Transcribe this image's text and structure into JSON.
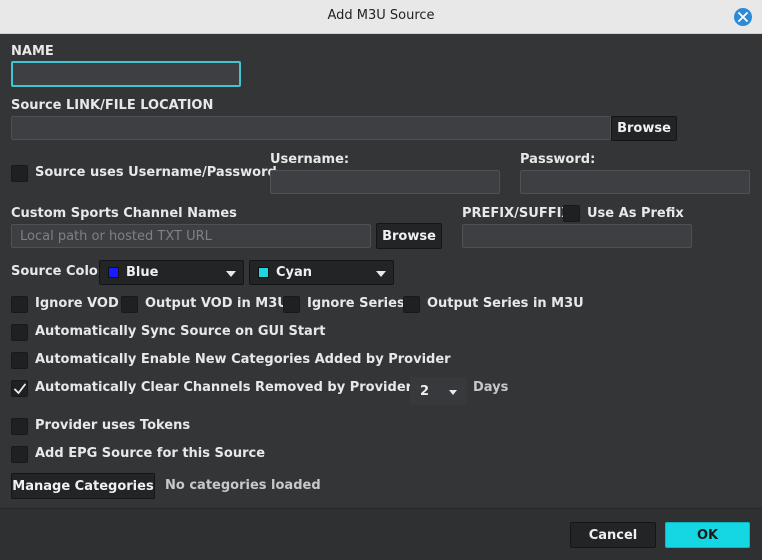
{
  "window": {
    "title": "Add M3U Source"
  },
  "name_section": {
    "label": "NAME",
    "value": ""
  },
  "source_section": {
    "label": "Source LINK/FILE LOCATION",
    "value": "",
    "browse_label": "Browse"
  },
  "credentials": {
    "checkbox_label": "Source uses Username/Password",
    "checked": false,
    "username_label": "Username:",
    "username_value": "",
    "password_label": "Password:",
    "password_value": ""
  },
  "sports": {
    "label": "Custom Sports Channel Names",
    "placeholder": "Local path or hosted TXT URL",
    "browse_label": "Browse"
  },
  "prefix": {
    "label": "PREFIX/SUFFIX",
    "checkbox_label": "Use As Prefix",
    "checked": false,
    "value": ""
  },
  "source_color": {
    "label": "Source Color",
    "primary": {
      "text": "Blue",
      "swatch": "#1a1aff"
    },
    "secondary": {
      "text": "Cyan",
      "swatch": "#22d6e0"
    }
  },
  "options": {
    "ignore_vod": "Ignore VOD",
    "output_vod": "Output VOD in M3U",
    "ignore_series": "Ignore Series",
    "output_series": "Output Series in M3U",
    "auto_sync": "Automatically Sync Source on GUI Start",
    "auto_enable": "Automatically Enable New Categories Added by Provider",
    "auto_clear": "Automatically Clear Channels Removed by Provider After",
    "auto_clear_checked": true,
    "days_value": "2",
    "days_label": "Days",
    "tokens": "Provider uses Tokens",
    "epg": "Add EPG Source for this Source"
  },
  "categories": {
    "button_label": "Manage Categories",
    "status": "No categories loaded"
  },
  "footer": {
    "cancel_label": "Cancel",
    "ok_label": "OK"
  },
  "colors": {
    "accent": "#3ec6d4",
    "ok_button": "#14d7e3",
    "close_button": "#2d8ad8"
  }
}
